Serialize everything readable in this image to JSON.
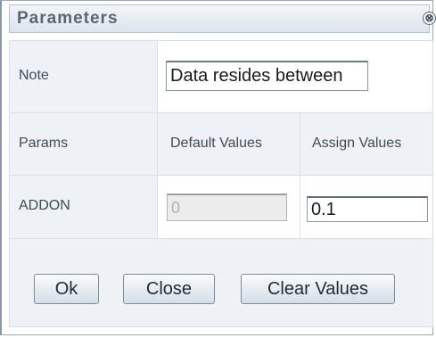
{
  "dialog": {
    "title": "Parameters",
    "close_icon": "⊗"
  },
  "rows": {
    "note": {
      "label": "Note",
      "value": "Data resides between"
    },
    "params_header": {
      "label": "Params",
      "default_header": "Default Values",
      "assign_header": "Assign Values"
    },
    "addon": {
      "label": "ADDON",
      "default_value": "0",
      "assign_value": "0.1"
    }
  },
  "buttons": {
    "ok": "Ok",
    "close": "Close",
    "clear": "Clear Values"
  },
  "colors": {
    "label_cell_bg": "#eef2f6",
    "title_text": "#5a6673",
    "border": "#d7dfe7"
  }
}
